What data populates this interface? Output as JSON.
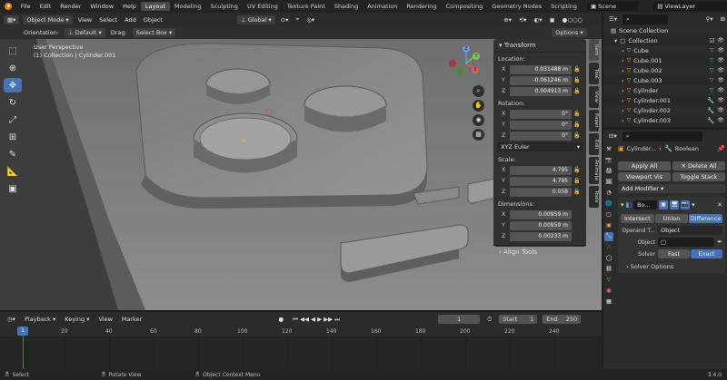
{
  "menu": [
    "File",
    "Edit",
    "Render",
    "Window",
    "Help"
  ],
  "workspaces": [
    "Layout",
    "Modeling",
    "Sculpting",
    "UV Editing",
    "Texture Paint",
    "Shading",
    "Animation",
    "Rendering",
    "Compositing",
    "Geometry Nodes",
    "Scripting"
  ],
  "active_workspace": "Layout",
  "scene_name": "Scene",
  "view_layer": "ViewLayer",
  "view_header": {
    "mode": "Object Mode",
    "menus": [
      "View",
      "Select",
      "Add",
      "Object"
    ],
    "transform_orientation": "Global"
  },
  "tool_header": {
    "orientation_label": "Orientation:",
    "orientation_value": "Default",
    "drag_label": "Drag:",
    "drag_value": "Select Box",
    "options": "Options"
  },
  "viewport": {
    "line1": "User Perspective",
    "line2": "(1) Collection | Cylinder.001"
  },
  "npanel": {
    "title": "Transform",
    "location_label": "Location:",
    "location": [
      {
        "axis": "X",
        "value": "0.031488 m"
      },
      {
        "axis": "Y",
        "value": "-0.061246 m"
      },
      {
        "axis": "Z",
        "value": "0.004913 m"
      }
    ],
    "rotation_label": "Rotation:",
    "rotation": [
      {
        "axis": "X",
        "value": "0°"
      },
      {
        "axis": "Y",
        "value": "0°"
      },
      {
        "axis": "Z",
        "value": "0°"
      }
    ],
    "rotation_mode": "XYZ Euler",
    "scale_label": "Scale:",
    "scale": [
      {
        "axis": "X",
        "value": "4.795"
      },
      {
        "axis": "Y",
        "value": "4.795"
      },
      {
        "axis": "Z",
        "value": "0.058"
      }
    ],
    "dimensions_label": "Dimensions:",
    "dimensions": [
      {
        "axis": "X",
        "value": "0.00959 m"
      },
      {
        "axis": "Y",
        "value": "0.00959 m"
      },
      {
        "axis": "Z",
        "value": "0.00233 m"
      }
    ],
    "align_tools": "Align Tools",
    "tabs": [
      "Item",
      "Tool",
      "View",
      "Paper",
      "Edit",
      "Animate",
      "Tools"
    ]
  },
  "outliner": {
    "scene_collection": "Scene Collection",
    "collection": "Collection",
    "items": [
      "Cube",
      "Cube.001",
      "Cube.002",
      "Cube.003",
      "Cylinder",
      "Cylinder.001",
      "Cylinder.002",
      "Cylinder.003"
    ]
  },
  "properties": {
    "object_name": "Cylinder...",
    "modifier_header": "Boolean",
    "apply_all": "Apply All",
    "delete_all": "Delete All",
    "viewport_vis": "Viewport Vis",
    "toggle_stack": "Toggle Stack",
    "add_modifier": "Add Modifier",
    "modifier_short": "Bo...",
    "ops": [
      "Intersect",
      "Union",
      "Difference"
    ],
    "active_op": "Difference",
    "operand_label": "Operand T...",
    "operand_value": "Object",
    "object_label": "Object",
    "solver_label": "Solver",
    "solver_fast": "Fast",
    "solver_exact": "Exact",
    "solver_options": "Solver Options"
  },
  "timeline": {
    "menus": [
      "Playback",
      "Keying",
      "View",
      "Marker"
    ],
    "current_frame": "1",
    "start_label": "Start",
    "start": "1",
    "end_label": "End",
    "end": "250",
    "ticks": [
      "1",
      "20",
      "40",
      "60",
      "80",
      "100",
      "120",
      "140",
      "160",
      "180",
      "200",
      "220",
      "240"
    ]
  },
  "statusbar": {
    "select": "Select",
    "rotate": "Rotate View",
    "context": "Object Context Menu",
    "version": "3.4.0"
  },
  "colors": {
    "accent": "#4772b3",
    "orange": "#ff9d35",
    "bg": "#3d3d3d"
  }
}
